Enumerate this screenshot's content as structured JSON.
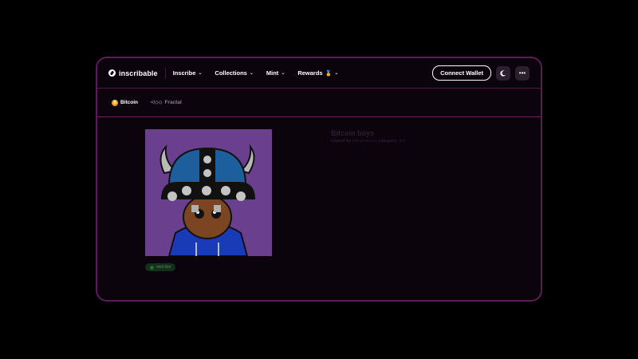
{
  "header": {
    "logo_text": "inscribable",
    "nav": [
      {
        "label": "Inscribe"
      },
      {
        "label": "Collections"
      },
      {
        "label": "Mint"
      },
      {
        "label": "Rewards"
      }
    ],
    "rewards_badge": "🏅",
    "connect_label": "Connect Wallet",
    "theme_icon": "moon-icon",
    "more_icon": "more-icon"
  },
  "chains": [
    {
      "label": "Bitcoin",
      "icon": "bitcoin-icon",
      "active": true
    },
    {
      "label": "Fractal",
      "icon": "fractal-icon",
      "active": false
    }
  ],
  "collection": {
    "title": "Bitcoin boys",
    "created_by_label": "owned by",
    "creator": "bitcoinboys",
    "category_label": "category:",
    "category": "Art"
  },
  "mint_status": "mint live",
  "colors": {
    "accent": "#6b2366",
    "bitcoin": "#f59a1b",
    "art_bg": "#6a3f8d",
    "helmet": "#1d5f9c",
    "hoodie": "#1a3bb8"
  }
}
